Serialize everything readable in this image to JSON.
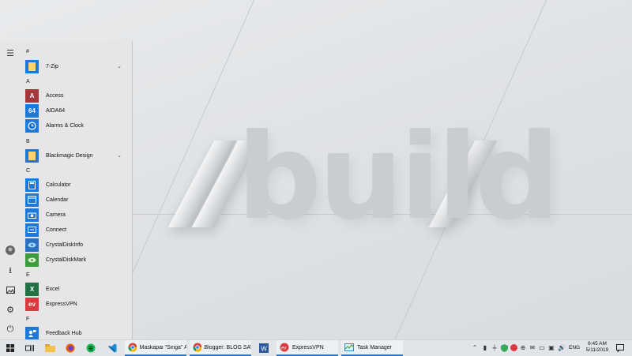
{
  "wallpaper": {
    "logo_text": "build"
  },
  "start_menu": {
    "rail": [
      "hamburger-icon",
      "user-avatar-icon",
      "downloads-icon",
      "pictures-icon",
      "settings-icon",
      "power-icon"
    ],
    "sections": [
      {
        "letter": "#",
        "apps": [
          {
            "label": "7-Zip",
            "icon": "folder-icon",
            "color": "#1e78d7",
            "expandable": true
          }
        ]
      },
      {
        "letter": "A",
        "apps": [
          {
            "label": "Access",
            "icon": "access-icon",
            "color": "#a4373a"
          },
          {
            "label": "AIDA64",
            "icon": "aida64-icon",
            "color": "#1e78d7",
            "glyph": "64"
          },
          {
            "label": "Alarms & Clock",
            "icon": "alarm-clock-icon",
            "color": "#1e78d7"
          }
        ]
      },
      {
        "letter": "B",
        "apps": [
          {
            "label": "Blackmagic Design",
            "icon": "folder-icon",
            "color": "#1e78d7",
            "expandable": true
          }
        ]
      },
      {
        "letter": "C",
        "apps": [
          {
            "label": "Calculator",
            "icon": "calculator-icon",
            "color": "#1e78d7"
          },
          {
            "label": "Calendar",
            "icon": "calendar-icon",
            "color": "#1e78d7"
          },
          {
            "label": "Camera",
            "icon": "camera-icon",
            "color": "#1e78d7"
          },
          {
            "label": "Connect",
            "icon": "connect-icon",
            "color": "#1e78d7"
          },
          {
            "label": "CrystalDiskInfo",
            "icon": "crystaldiskinfo-icon",
            "color": "#2a6fc0"
          },
          {
            "label": "CrystalDiskMark",
            "icon": "crystaldiskmark-icon",
            "color": "#3d9a3d"
          }
        ]
      },
      {
        "letter": "E",
        "apps": [
          {
            "label": "Excel",
            "icon": "excel-icon",
            "color": "#217346"
          },
          {
            "label": "ExpressVPN",
            "icon": "expressvpn-icon",
            "color": "#da3940"
          }
        ]
      },
      {
        "letter": "F",
        "apps": [
          {
            "label": "Feedback Hub",
            "icon": "feedback-hub-icon",
            "color": "#1e78d7"
          }
        ]
      }
    ]
  },
  "taskbar": {
    "tasks": [
      {
        "label": "Maskapai \"Singa\" A...",
        "icon": "chrome-icon"
      },
      {
        "label": "Blogger: BLOG SAY...",
        "icon": "chrome-icon"
      },
      {
        "label": "ExpressVPN",
        "icon": "expressvpn-icon"
      },
      {
        "label": "Task Manager",
        "icon": "task-manager-icon"
      }
    ],
    "tray": {
      "language": "ENG",
      "time": "6:45 AM",
      "date": "5/11/2019"
    }
  }
}
